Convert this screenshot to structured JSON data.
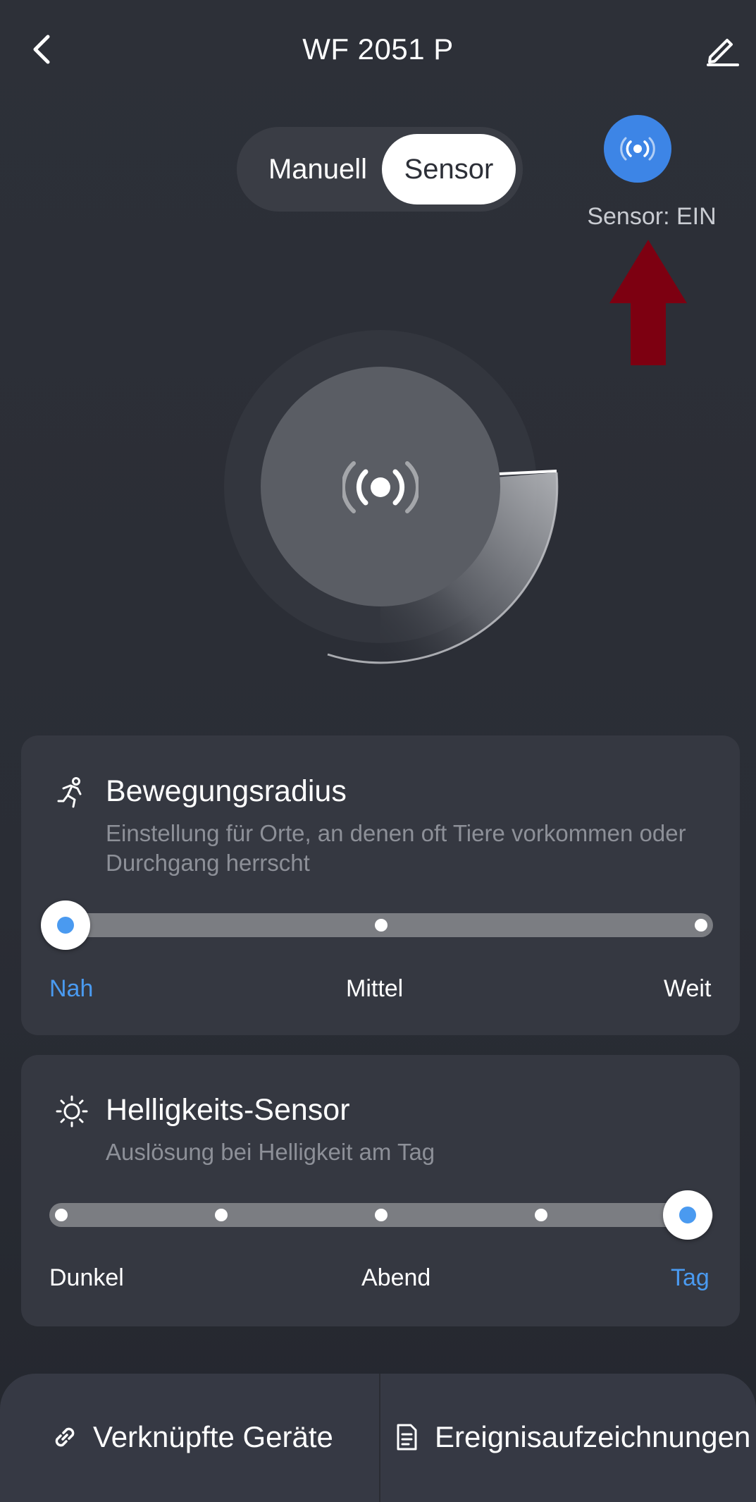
{
  "header": {
    "title": "WF 2051 P",
    "back_icon": "chevron-left-icon",
    "edit_icon": "pencil-icon"
  },
  "mode_toggle": {
    "options": [
      "Manuell",
      "Sensor"
    ],
    "selected": "Sensor"
  },
  "sensor": {
    "icon": "broadcast-icon",
    "status_text": "Sensor: EIN",
    "accent_color": "#3d85e6"
  },
  "dial": {
    "icon": "broadcast-icon"
  },
  "motion_radius": {
    "icon": "running-person-icon",
    "title": "Bewegungsradius",
    "description": "Einstellung für Orte, an denen oft Tiere vorkommen oder Durchgang herrscht",
    "labels": [
      "Nah",
      "Mittel",
      "Weit"
    ],
    "selected_index": 0
  },
  "brightness_sensor": {
    "icon": "sun-icon",
    "title": "Helligkeits-Sensor",
    "description": "Auslösung bei Helligkeit am Tag",
    "labels": [
      "Dunkel",
      "Abend",
      "Tag"
    ],
    "steps": 5,
    "selected_index": 4,
    "selected_label": "Tag"
  },
  "bottom_bar": {
    "linked_devices": {
      "icon": "link-icon",
      "label": "Verknüpfte Geräte"
    },
    "event_log": {
      "icon": "document-icon",
      "label": "Ereignisaufzeichnungen"
    }
  },
  "colors": {
    "active": "#4a9af0",
    "annotation_arrow": "#7d0011"
  }
}
